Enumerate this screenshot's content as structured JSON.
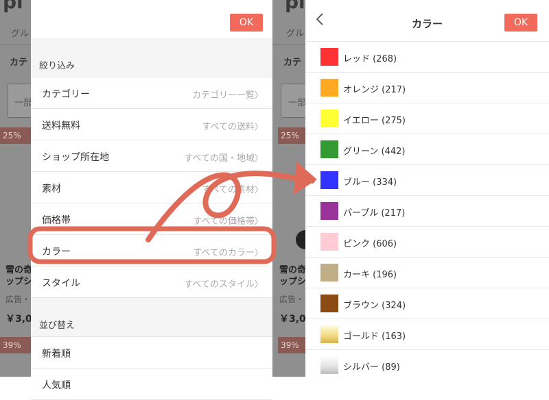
{
  "background": {
    "left": {
      "logo": "pi",
      "nav": "グル",
      "category": "カテ",
      "search_fragment": "一部",
      "discounts": [
        "25%",
        "39%"
      ],
      "product_lines": [
        "雪の奇",
        "ップシ"
      ],
      "ad_text": "広告・",
      "price": "￥3,0"
    },
    "right": {
      "logo": "pi",
      "nav": "グル",
      "category": "カテ",
      "search_fragment": "一部",
      "discounts": [
        "25%",
        "39%"
      ],
      "product_lines": [
        "雪の奇",
        "ップシ"
      ],
      "ad_text": "広告・",
      "price": "￥3,0"
    }
  },
  "filter_panel": {
    "ok_label": "OK",
    "filter_section_title": "絞り込み",
    "rows": [
      {
        "label": "カテゴリー",
        "value": "カテゴリー一覧"
      },
      {
        "label": "送料無料",
        "value": "すべての送料"
      },
      {
        "label": "ショップ所在地",
        "value": "すべての国・地域"
      },
      {
        "label": "素材",
        "value": "すべての素材"
      },
      {
        "label": "価格帯",
        "value": "すべての価格帯"
      },
      {
        "label": "カラー",
        "value": "すべてのカラー"
      },
      {
        "label": "スタイル",
        "value": "すべてのスタイル"
      }
    ],
    "sort_section_title": "並び替え",
    "sort_rows": [
      {
        "label": "新着順"
      },
      {
        "label": "人気順"
      }
    ]
  },
  "color_panel": {
    "back_icon": "chevron-left-icon",
    "title": "カラー",
    "ok_label": "OK",
    "colors": [
      {
        "label": "レッド (268)",
        "swatch": "#ff3333"
      },
      {
        "label": "オレンジ (217)",
        "swatch": "#ffaa22"
      },
      {
        "label": "イエロー (275)",
        "swatch": "#ffff33"
      },
      {
        "label": "グリーン (442)",
        "swatch": "#339933"
      },
      {
        "label": "ブルー (334)",
        "swatch": "#3333ff"
      },
      {
        "label": "パープル (217)",
        "swatch": "#993399"
      },
      {
        "label": "ピンク (606)",
        "swatch": "#ffccd5"
      },
      {
        "label": "カーキ (196)",
        "swatch": "#bfae86"
      },
      {
        "label": "ブラウン (324)",
        "swatch": "#8b4c14"
      },
      {
        "label": "ゴールド (163)",
        "swatch": "gold-gradient"
      },
      {
        "label": "シルバー (89)",
        "swatch": "silver-gradient"
      }
    ]
  },
  "colors": {
    "accent": "#f26a5c",
    "annotation": "#e06a58",
    "overlay": "#8f8f8f"
  }
}
